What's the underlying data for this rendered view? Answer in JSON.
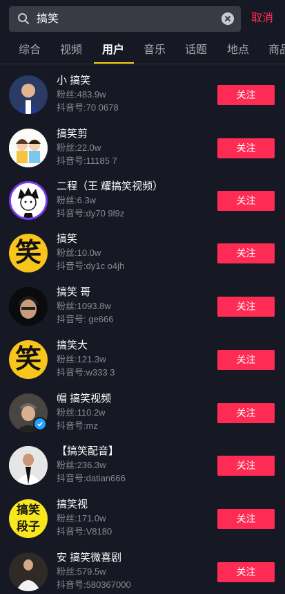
{
  "search": {
    "query": "搞笑",
    "cancel_label": "取消"
  },
  "tabs": [
    {
      "label": "综合"
    },
    {
      "label": "视频"
    },
    {
      "label": "用户"
    },
    {
      "label": "音乐"
    },
    {
      "label": "话题"
    },
    {
      "label": "地点"
    },
    {
      "label": "商品"
    }
  ],
  "active_tab": "用户",
  "follow_label": "关注",
  "results": [
    {
      "name": "小 搞笑",
      "fans": "粉丝:483.9w",
      "douyin_id": "抖音号:70 0678"
    },
    {
      "name": "搞笑剪",
      "fans": "粉丝:22.0w",
      "douyin_id": "抖音号:11185 7"
    },
    {
      "name": "二程（王 耀搞笑视频）",
      "fans": "粉丝:6.3w",
      "douyin_id": "抖音号:dy70 9l9z"
    },
    {
      "name": "搞笑",
      "fans": "粉丝:10.0w",
      "douyin_id": "抖音号:dy1c o4jh"
    },
    {
      "name": "搞笑 哥",
      "fans": "粉丝:1093.8w",
      "douyin_id": "抖音号: ge666"
    },
    {
      "name": "搞笑大",
      "fans": "粉丝:121.3w",
      "douyin_id": "抖音号:w333 3"
    },
    {
      "name": "帽 搞笑视频",
      "fans": "粉丝:110.2w",
      "douyin_id": "抖音号:mz"
    },
    {
      "name": "【搞笑配音】",
      "fans": "粉丝:236.3w",
      "douyin_id": "抖音号:datian666"
    },
    {
      "name": "搞笑视",
      "fans": "粉丝:171.0w",
      "douyin_id": "抖音号:V8180"
    },
    {
      "name": "安 搞笑微喜剧",
      "fans": "粉丝:579.5w",
      "douyin_id": "抖音号:580367000"
    }
  ],
  "avatar_text": {
    "r4": "笑",
    "r6": "笑",
    "r9_line1": "搞笑",
    "r9_line2": "段子"
  }
}
